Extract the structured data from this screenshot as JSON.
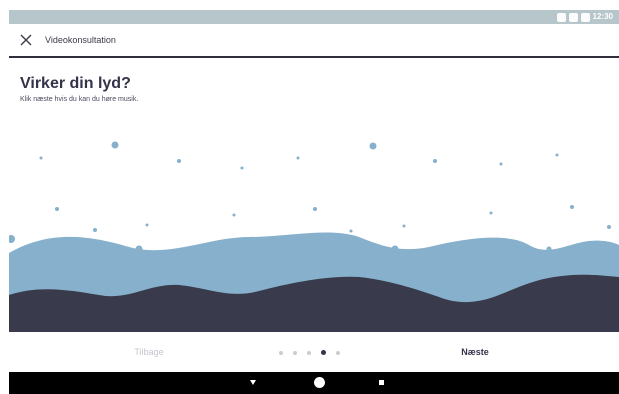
{
  "status_bar": {
    "time": "12:30"
  },
  "toolbar": {
    "title": "Videokonsultation",
    "close_icon": "close-icon"
  },
  "content": {
    "heading": "Virker din lyd?",
    "subheading": "Klik næste hvis du kan du høre musik."
  },
  "navigation": {
    "back_label": "Tilbage",
    "next_label": "Næste",
    "pages": 5,
    "current_page": 4
  },
  "system_nav": {
    "back_icon": "back-icon",
    "home_icon": "home-icon",
    "recent_icon": "recent-apps-icon"
  },
  "colors": {
    "status_bar": "#b7c6cb",
    "wave_light": "#86b0cc",
    "wave_dark": "#393a4b",
    "accent_text": "#34334a",
    "disabled_text": "#c3c6cf"
  }
}
